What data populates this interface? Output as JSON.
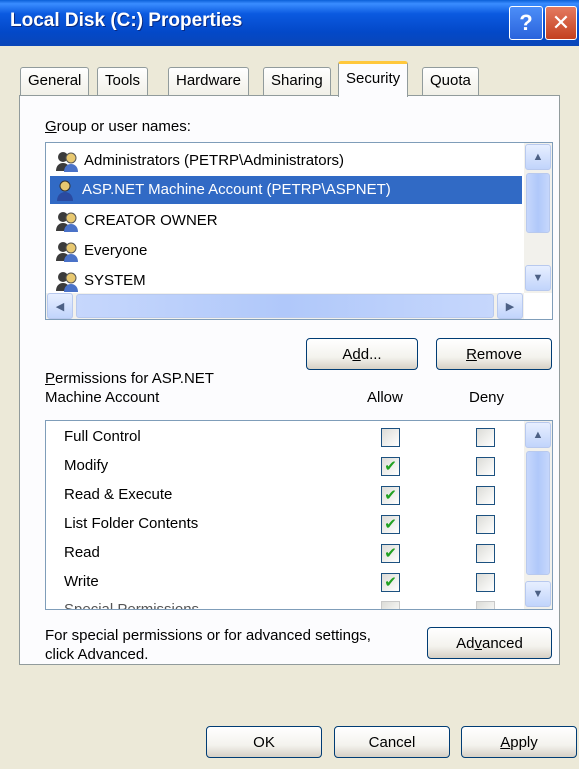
{
  "window": {
    "title": "Local Disk (C:) Properties",
    "help_glyph": "?",
    "close_glyph": "✕"
  },
  "tabs": [
    "General",
    "Tools",
    "Hardware",
    "Sharing",
    "Security",
    "Quota"
  ],
  "active_tab": "Security",
  "groups": {
    "label_prefix": "G",
    "label_rest": "roup or user names:",
    "items": [
      {
        "name": "Administrators (PETRP\\Administrators)",
        "selected": false
      },
      {
        "name": "ASP.NET Machine Account (PETRP\\ASPNET)",
        "selected": true
      },
      {
        "name": "CREATOR OWNER",
        "selected": false
      },
      {
        "name": "Everyone",
        "selected": false
      },
      {
        "name": "SYSTEM",
        "selected": false
      }
    ]
  },
  "buttons": {
    "add_pre": "A",
    "add_ul": "d",
    "add_post": "d...",
    "remove_ul": "R",
    "remove_post": "emove",
    "advanced_pre": "Ad",
    "advanced_ul": "v",
    "advanced_post": "anced",
    "ok": "OK",
    "cancel": "Cancel",
    "apply_ul": "A",
    "apply_post": "pply"
  },
  "permissions": {
    "label_ul": "P",
    "label_line1_rest": "ermissions for ASP.NET",
    "label_line2": "Machine Account",
    "allow_header": "Allow",
    "deny_header": "Deny",
    "rows": [
      {
        "name": "Full Control",
        "allow": false,
        "deny": false
      },
      {
        "name": "Modify",
        "allow": true,
        "deny": false
      },
      {
        "name": "Read & Execute",
        "allow": true,
        "deny": false
      },
      {
        "name": "List Folder Contents",
        "allow": true,
        "deny": false
      },
      {
        "name": "Read",
        "allow": true,
        "deny": false
      },
      {
        "name": "Write",
        "allow": true,
        "deny": false
      },
      {
        "name": "Special Permissions",
        "allow": false,
        "deny": false
      }
    ]
  },
  "advanced_note": {
    "line1": "For special permissions or for advanced settings,",
    "line2": "click Advanced."
  },
  "icons": {
    "user_group": "user-group-icon",
    "scroll_up": "▲",
    "scroll_down": "▼",
    "scroll_left": "◀",
    "scroll_right": "▶",
    "check": "✔"
  },
  "colors": {
    "selection": "#316ac5",
    "titlebar": "#0348c8",
    "check": "#21a121"
  }
}
